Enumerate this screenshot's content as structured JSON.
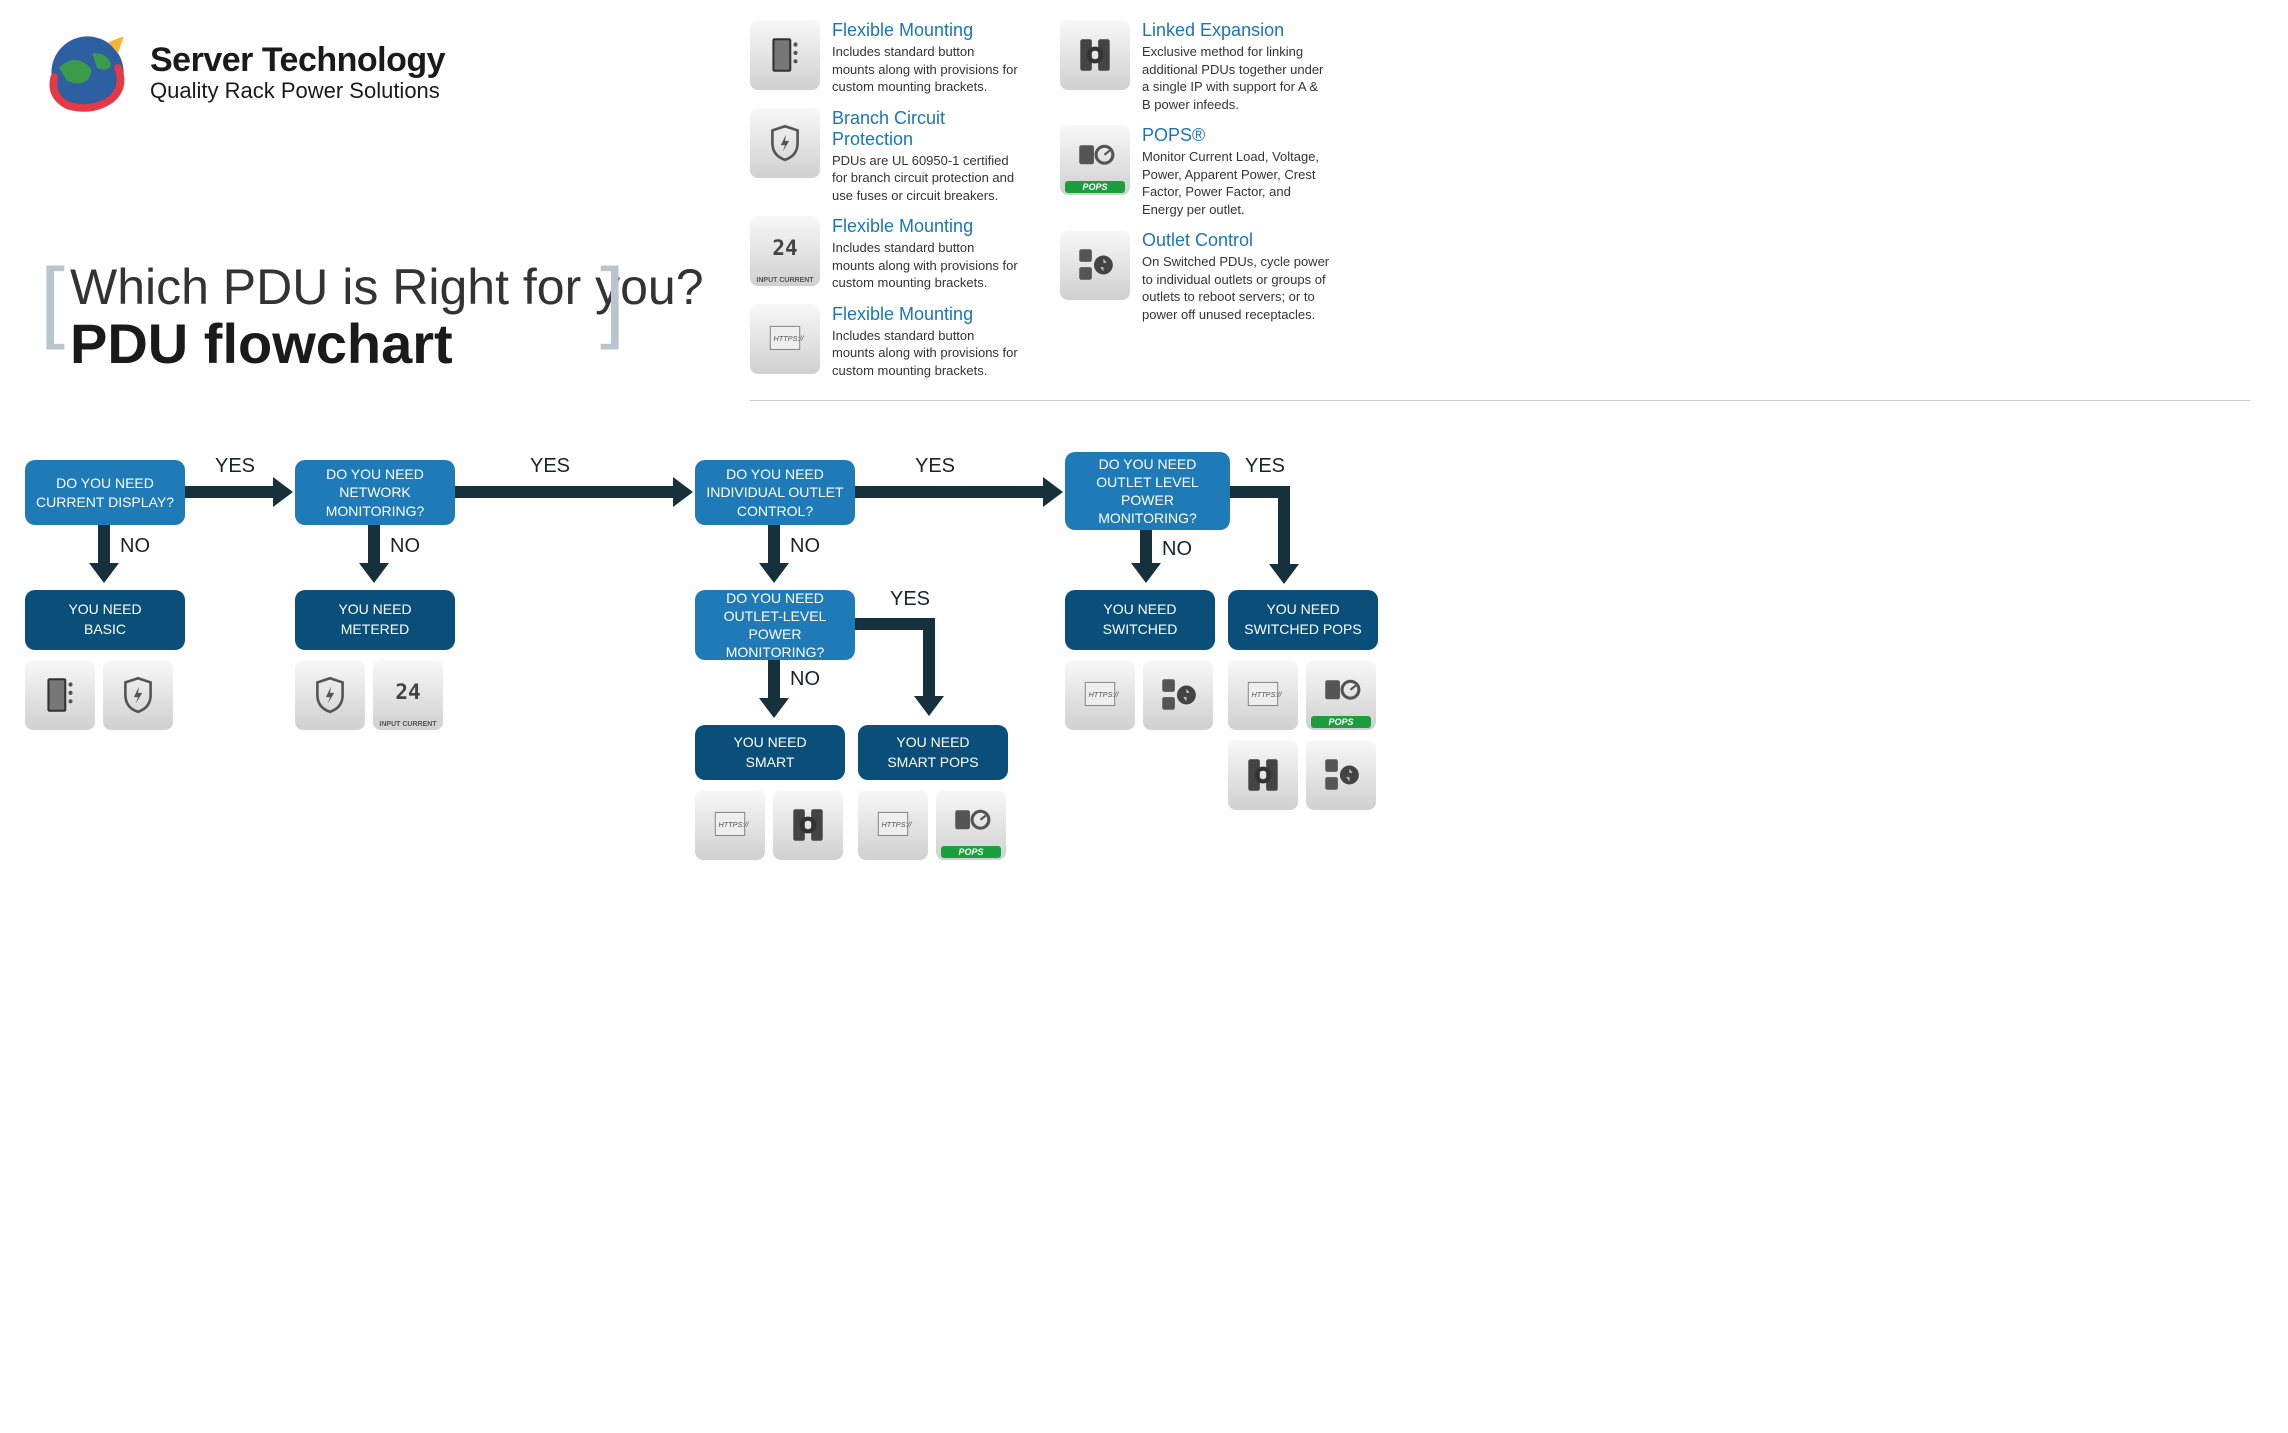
{
  "logo": {
    "title": "Server Technology",
    "subtitle": "Quality Rack Power Solutions"
  },
  "header": {
    "line1": "Which PDU is Right for you?",
    "line2": "PDU flowchart"
  },
  "features": {
    "col1": [
      {
        "title": "Flexible Mounting",
        "desc": "Includes standard button mounts along with provisions for custom mounting brackets.",
        "icon": "rack"
      },
      {
        "title": "Branch Circuit Protection",
        "desc": "PDUs are UL 60950-1 certified for branch circuit protection and use fuses or circuit breakers.",
        "icon": "shield"
      },
      {
        "title": "Flexible Mounting",
        "desc": "Includes standard button mounts along with provisions for custom mounting brackets.",
        "icon": "display24"
      },
      {
        "title": "Flexible Mounting",
        "desc": "Includes standard button mounts along with provisions for custom mounting brackets.",
        "icon": "https"
      }
    ],
    "col2": [
      {
        "title": "Linked Expansion",
        "desc": "Exclusive method for linking additional PDUs together under a single IP with support for A & B power infeeds.",
        "icon": "link"
      },
      {
        "title": "POPS®",
        "desc": "Monitor Current Load, Voltage, Power, Apparent Power, Crest Factor, Power Factor, and Energy per outlet.",
        "icon": "pops"
      },
      {
        "title": "Outlet Control",
        "desc": "On Switched PDUs, cycle power to individual outlets or groups of outlets to reboot servers; or to power off unused receptacles.",
        "icon": "outlet"
      }
    ]
  },
  "labels": {
    "yes": "YES",
    "no": "NO"
  },
  "flow": {
    "q1": "DO YOU NEED CURRENT DISPLAY?",
    "q2": "DO YOU NEED NETWORK MONITORING?",
    "q3": "DO YOU NEED INDIVIDUAL OUTLET CONTROL?",
    "q4": "DO YOU NEED OUTLET LEVEL POWER MONITORING?",
    "q3b": "DO YOU NEED OUTLET-LEVEL POWER MONITORING?",
    "r1": "YOU NEED\nBASIC",
    "r2": "YOU NEED\nMETERED",
    "r3": "YOU NEED\nSMART",
    "r3b": "YOU NEED\nSMART POPS",
    "r4": "YOU NEED\nSWITCHED",
    "r5": "YOU NEED\nSWITCHED POPS"
  },
  "iconLabels": {
    "inputCurrent": "INPUT CURRENT",
    "https": "HTTPS://",
    "pops": "POPS"
  }
}
